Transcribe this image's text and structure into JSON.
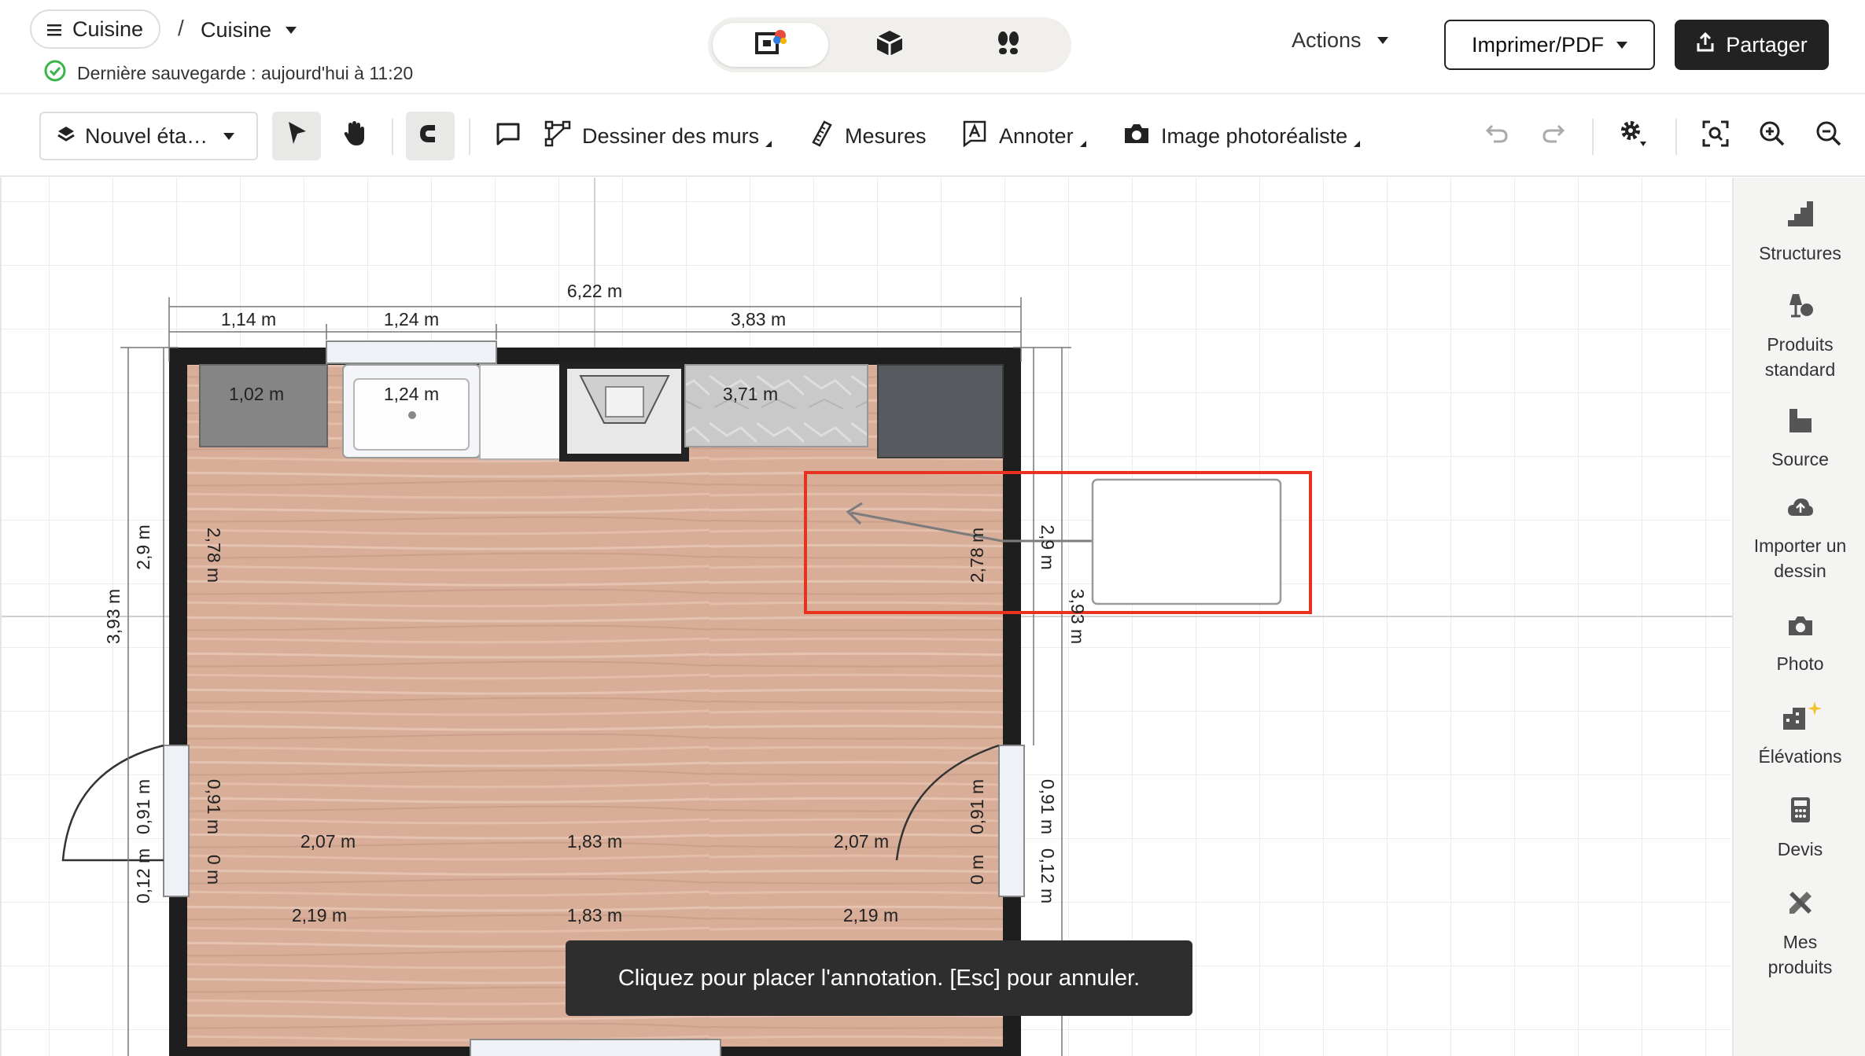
{
  "header": {
    "project_name": "Cuisine",
    "breadcrumb_separator": "/",
    "current_room": "Cuisine",
    "save_status": "Dernière sauvegarde : aujourd'hui à 11:20",
    "actions_label": "Actions",
    "print_label": "Imprimer/PDF",
    "share_label": "Partager"
  },
  "toolbar": {
    "level_label": "Nouvel éta…",
    "draw_walls_label": "Dessiner des murs",
    "measures_label": "Mesures",
    "annotate_label": "Annoter",
    "photoreal_label": "Image photoréaliste"
  },
  "plan": {
    "dims": {
      "overall_top": "6,22 m",
      "top_seg_1": "1,14 m",
      "top_seg_2": "1,24 m",
      "top_seg_3": "3,83 m",
      "inner_1": "1,02 m",
      "inner_2": "1,24 m",
      "inner_3": "3,71 m",
      "left_outer": "3,93 m",
      "left_seg": "2,9 m",
      "left_inner": "2,78 m",
      "right_inner": "2,78 m",
      "right_seg": "2,9 m",
      "right_outer": "3,93 m",
      "door_left_outer": "0,91 m",
      "door_left_inner": "0,91 m",
      "door_right_inner": "0,91 m",
      "door_right_outer": "0,91 m",
      "bottom_left_small": "0,12 m",
      "bottom_right_small": "0,12 m",
      "zero_left": "0 m",
      "zero_right": "0 m",
      "bottom_inner_1": "2,07 m",
      "bottom_inner_2": "1,83 m",
      "bottom_inner_3": "2,07 m",
      "bottom_outer_1": "2,19 m",
      "bottom_outer_2": "1,83 m",
      "bottom_outer_3": "2,19 m"
    }
  },
  "sidebar": {
    "items": [
      {
        "label": "Structures"
      },
      {
        "label": "Produits standard"
      },
      {
        "label": "Source"
      },
      {
        "label": "Importer un dessin"
      },
      {
        "label": "Photo"
      },
      {
        "label": "Élévations"
      },
      {
        "label": "Devis"
      },
      {
        "label": "Mes produits"
      }
    ]
  },
  "toast": {
    "message": "Cliquez pour placer l'annotation. [Esc] pour annuler."
  },
  "colors": {
    "accent_save": "#3bb44a",
    "highlight": "#e8321d",
    "floor": "#d6ad98",
    "wall": "#1e1e1e"
  }
}
